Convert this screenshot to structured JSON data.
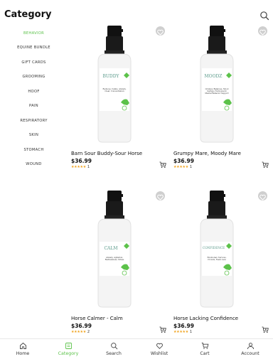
{
  "header": {
    "title": "Category"
  },
  "sidebar": {
    "items": [
      {
        "label": "BEHAVIOR",
        "active": true
      },
      {
        "label": "EQUINE BUNDLE",
        "active": false
      },
      {
        "label": "GIFT CARDS",
        "active": false
      },
      {
        "label": "GROOMING",
        "active": false
      },
      {
        "label": "HOOF",
        "active": false
      },
      {
        "label": "PAIN",
        "active": false
      },
      {
        "label": "RESPIRATORY",
        "active": false
      },
      {
        "label": "SKIN",
        "active": false
      },
      {
        "label": "STOMACH",
        "active": false
      },
      {
        "label": "WOUND",
        "active": false
      }
    ]
  },
  "products": [
    {
      "name": "Barn Sour Buddy-Sour Horse",
      "price": "$36.99",
      "stars": "★★★★★",
      "rating_count": "1",
      "label_brand": "BUDDY",
      "label_lines": "Reduces, Calms, Anxiety, Clear, Concentration"
    },
    {
      "name": "Grumpy Mare, Moody Mare",
      "price": "$36.99",
      "stars": "★★★★★",
      "rating_count": "1",
      "label_brand": "MOODZ",
      "label_lines": "Grumpy, Balances, Mood Swings, Hormonal & Mental Behavior Support"
    },
    {
      "name": "Horse Calmer - Calm",
      "price": "$36.99",
      "stars": "★★★★★",
      "rating_count": "2",
      "label_brand": "CALM",
      "label_lines": "Anxiety, Agitation, Restlessness, Stress"
    },
    {
      "name": "Horse Lacking Confidence",
      "price": "$36.99",
      "stars": "★★★★★",
      "rating_count": "1",
      "label_brand": "CONFIDENCE",
      "label_lines": "Emotional, Nervous, Crowds, Fears Less"
    }
  ],
  "bottom_nav": [
    {
      "label": "Home",
      "icon": "home-icon",
      "active": false
    },
    {
      "label": "Category",
      "icon": "category-icon",
      "active": true
    },
    {
      "label": "Search",
      "icon": "search-icon",
      "active": false
    },
    {
      "label": "Wishlist",
      "icon": "heart-icon",
      "active": false
    },
    {
      "label": "Cart",
      "icon": "cart-icon",
      "active": false
    },
    {
      "label": "Account",
      "icon": "user-icon",
      "active": false
    }
  ],
  "colors": {
    "accent": "#5cc24a",
    "star": "#f0a21b",
    "fav_bg": "#cfcfcf"
  }
}
